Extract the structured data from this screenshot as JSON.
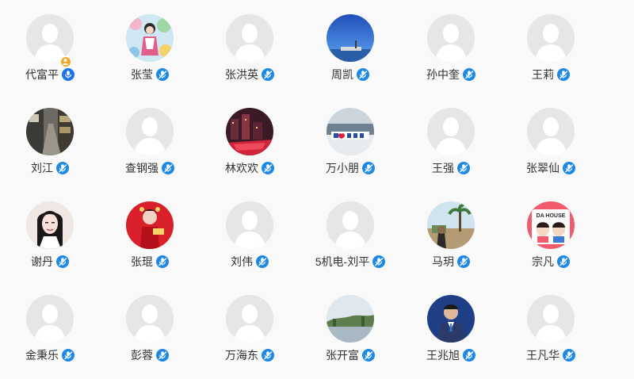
{
  "colors": {
    "page_background": "#f9f9f9",
    "mic_active": "#1a73e8",
    "mic_muted": "#1e88e5",
    "host_badge": "#f5a623",
    "placeholder_avatar": "#e6e6e6",
    "name_text": "#333333"
  },
  "participants": [
    {
      "name": "代富平",
      "avatar": "default",
      "mic": "on",
      "host": true
    },
    {
      "name": "张莹",
      "avatar": "photo-drawing",
      "mic": "muted",
      "host": false
    },
    {
      "name": "张洪英",
      "avatar": "default",
      "mic": "muted",
      "host": false
    },
    {
      "name": "周凯",
      "avatar": "photo-sea-sky",
      "mic": "muted",
      "host": false
    },
    {
      "name": "孙中奎",
      "avatar": "default",
      "mic": "muted",
      "host": false
    },
    {
      "name": "王莉",
      "avatar": "default",
      "mic": "muted",
      "host": false
    },
    {
      "name": "刘江",
      "avatar": "photo-street",
      "mic": "muted",
      "host": false
    },
    {
      "name": "查钢强",
      "avatar": "default",
      "mic": "muted",
      "host": false
    },
    {
      "name": "林欢欢",
      "avatar": "photo-night-city",
      "mic": "muted",
      "host": false
    },
    {
      "name": "万小朋",
      "avatar": "photo-lake-sign",
      "mic": "muted",
      "host": false
    },
    {
      "name": "王强",
      "avatar": "default",
      "mic": "muted",
      "host": false
    },
    {
      "name": "张翠仙",
      "avatar": "default",
      "mic": "muted",
      "host": false
    },
    {
      "name": "谢丹",
      "avatar": "photo-woman-portrait",
      "mic": "muted",
      "host": false
    },
    {
      "name": "张琨",
      "avatar": "photo-red-costume",
      "mic": "muted",
      "host": false
    },
    {
      "name": "刘伟",
      "avatar": "default",
      "mic": "muted",
      "host": false
    },
    {
      "name": "5机电-刘平",
      "avatar": "default",
      "mic": "muted",
      "host": false
    },
    {
      "name": "马玥",
      "avatar": "photo-palm-beach",
      "mic": "muted",
      "host": false
    },
    {
      "name": "宗凡",
      "avatar": "photo-da-house-cartoon",
      "mic": "muted",
      "host": false
    },
    {
      "name": "金秉乐",
      "avatar": "default",
      "mic": "muted",
      "host": false
    },
    {
      "name": "彭蓉",
      "avatar": "default",
      "mic": "muted",
      "host": false
    },
    {
      "name": "万海东",
      "avatar": "default",
      "mic": "muted",
      "host": false
    },
    {
      "name": "张开富",
      "avatar": "photo-landscape-trees",
      "mic": "muted",
      "host": false
    },
    {
      "name": "王兆旭",
      "avatar": "photo-man-suit",
      "mic": "muted",
      "host": false
    },
    {
      "name": "王凡华",
      "avatar": "default",
      "mic": "muted",
      "host": false
    }
  ],
  "avatar_texts": {
    "da_house": "DA HOUSE"
  }
}
